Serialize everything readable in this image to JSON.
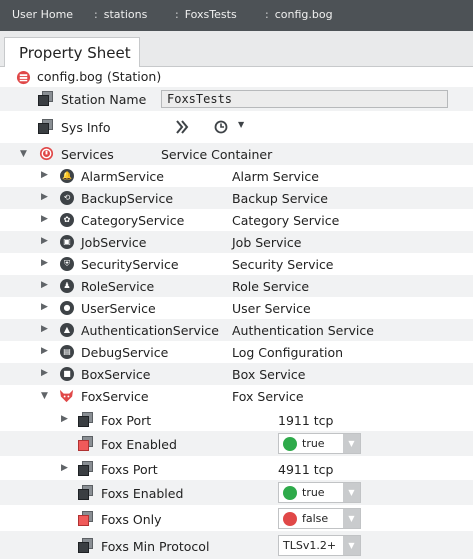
{
  "breadcrumb": [
    {
      "label": "User Home",
      "sep": ""
    },
    {
      "label": "stations",
      "sep": ":"
    },
    {
      "label": "FoxsTests",
      "sep": ":"
    },
    {
      "label": "config.bog",
      "sep": ":"
    }
  ],
  "tab": {
    "label": "Property Sheet"
  },
  "root": {
    "name": "config.bog",
    "type": "(Station)"
  },
  "station_name": {
    "label": "Station Name",
    "value": "FoxsTests"
  },
  "sys_info": {
    "label": "Sys Info"
  },
  "services": {
    "label": "Services",
    "type": "Service Container"
  },
  "service_items": [
    {
      "name": "AlarmService",
      "type": "Alarm Service",
      "icon": "bell-icon"
    },
    {
      "name": "BackupService",
      "type": "Backup Service",
      "icon": "backup-icon"
    },
    {
      "name": "CategoryService",
      "type": "Category Service",
      "icon": "category-icon"
    },
    {
      "name": "JobService",
      "type": "Job Service",
      "icon": "briefcase-icon"
    },
    {
      "name": "SecurityService",
      "type": "Security Service",
      "icon": "shield-icon"
    },
    {
      "name": "RoleService",
      "type": "Role Service",
      "icon": "role-icon"
    },
    {
      "name": "UserService",
      "type": "User Service",
      "icon": "user-icon"
    },
    {
      "name": "AuthenticationService",
      "type": "Authentication Service",
      "icon": "lock-icon"
    },
    {
      "name": "DebugService",
      "type": "Log Configuration",
      "icon": "debug-icon"
    },
    {
      "name": "BoxService",
      "type": "Box Service",
      "icon": "box-icon"
    }
  ],
  "fox_service": {
    "name": "FoxService",
    "type": "Fox Service",
    "icon": "fox-icon"
  },
  "fox_props": [
    {
      "name": "Fox Port",
      "value": "1911 tcp",
      "kind": "expandable"
    },
    {
      "name": "Fox Enabled",
      "value": "true",
      "kind": "bool",
      "dot_color": "#2eaa4a",
      "icon_red": true
    },
    {
      "name": "Foxs Port",
      "value": "4911 tcp",
      "kind": "expandable"
    },
    {
      "name": "Foxs Enabled",
      "value": "true",
      "kind": "bool",
      "dot_color": "#2eaa4a",
      "icon_red": false
    },
    {
      "name": "Foxs Only",
      "value": "false",
      "kind": "bool",
      "dot_color": "#e04848",
      "icon_red": true
    },
    {
      "name": "Foxs Min Protocol",
      "value": "TLSv1.2+",
      "kind": "enum",
      "icon_red": false
    }
  ],
  "colors": {
    "breadcrumb_bg": "#4d5256",
    "band": "#f1f2f3",
    "true_green": "#2eaa4a",
    "false_red": "#e04848",
    "root_icon": "#e04848"
  }
}
